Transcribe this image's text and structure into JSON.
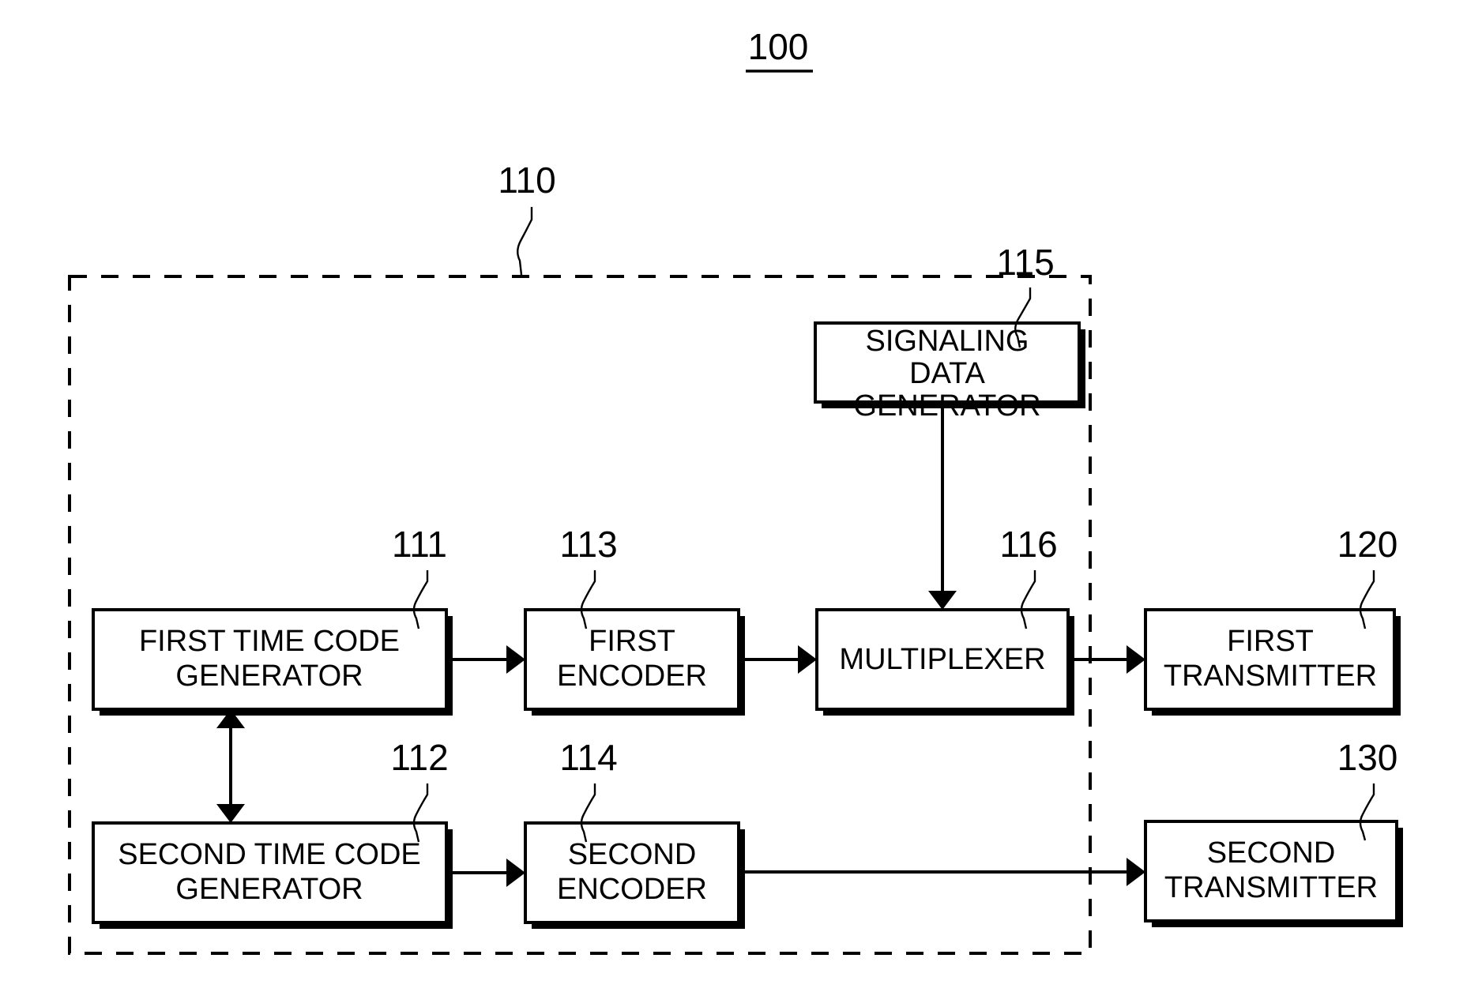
{
  "figure": {
    "title_ref": "100",
    "dashed_group_ref": "110"
  },
  "blocks": [
    {
      "ref": "115",
      "label_lines": [
        "SIGNALING",
        "DATA",
        "GENERATOR"
      ],
      "name": "signaling-data-generator"
    },
    {
      "ref": "111",
      "label_lines": [
        "FIRST TIME CODE",
        "GENERATOR"
      ],
      "name": "first-time-code-generator"
    },
    {
      "ref": "113",
      "label_lines": [
        "FIRST",
        "ENCODER"
      ],
      "name": "first-encoder"
    },
    {
      "ref": "116",
      "label_lines": [
        "MULTIPLEXER"
      ],
      "name": "multiplexer"
    },
    {
      "ref": "120",
      "label_lines": [
        "FIRST",
        "TRANSMITTER"
      ],
      "name": "first-transmitter"
    },
    {
      "ref": "112",
      "label_lines": [
        "SECOND TIME CODE",
        "GENERATOR"
      ],
      "name": "second-time-code-generator"
    },
    {
      "ref": "114",
      "label_lines": [
        "SECOND",
        "ENCODER"
      ],
      "name": "second-encoder"
    },
    {
      "ref": "130",
      "label_lines": [
        "SECOND",
        "TRANSMITTER"
      ],
      "name": "second-transmitter"
    }
  ],
  "colors": {
    "ink": "#000000",
    "paper": "#ffffff"
  },
  "chart_data": {
    "type": "diagram",
    "title": "100",
    "nodes": [
      {
        "id": "115",
        "label": "SIGNALING DATA GENERATOR"
      },
      {
        "id": "111",
        "label": "FIRST TIME CODE GENERATOR"
      },
      {
        "id": "113",
        "label": "FIRST ENCODER"
      },
      {
        "id": "116",
        "label": "MULTIPLEXER"
      },
      {
        "id": "120",
        "label": "FIRST TRANSMITTER"
      },
      {
        "id": "112",
        "label": "SECOND TIME CODE GENERATOR"
      },
      {
        "id": "114",
        "label": "SECOND ENCODER"
      },
      {
        "id": "130",
        "label": "SECOND TRANSMITTER"
      },
      {
        "id": "110",
        "label": "dashed enclosure"
      }
    ],
    "edges": [
      {
        "from": "111",
        "to": "113",
        "type": "arrow"
      },
      {
        "from": "113",
        "to": "116",
        "type": "arrow"
      },
      {
        "from": "115",
        "to": "116",
        "type": "arrow"
      },
      {
        "from": "116",
        "to": "120",
        "type": "arrow"
      },
      {
        "from": "111",
        "to": "112",
        "type": "double-arrow"
      },
      {
        "from": "112",
        "to": "114",
        "type": "arrow"
      },
      {
        "from": "114",
        "to": "130",
        "type": "arrow"
      }
    ]
  }
}
